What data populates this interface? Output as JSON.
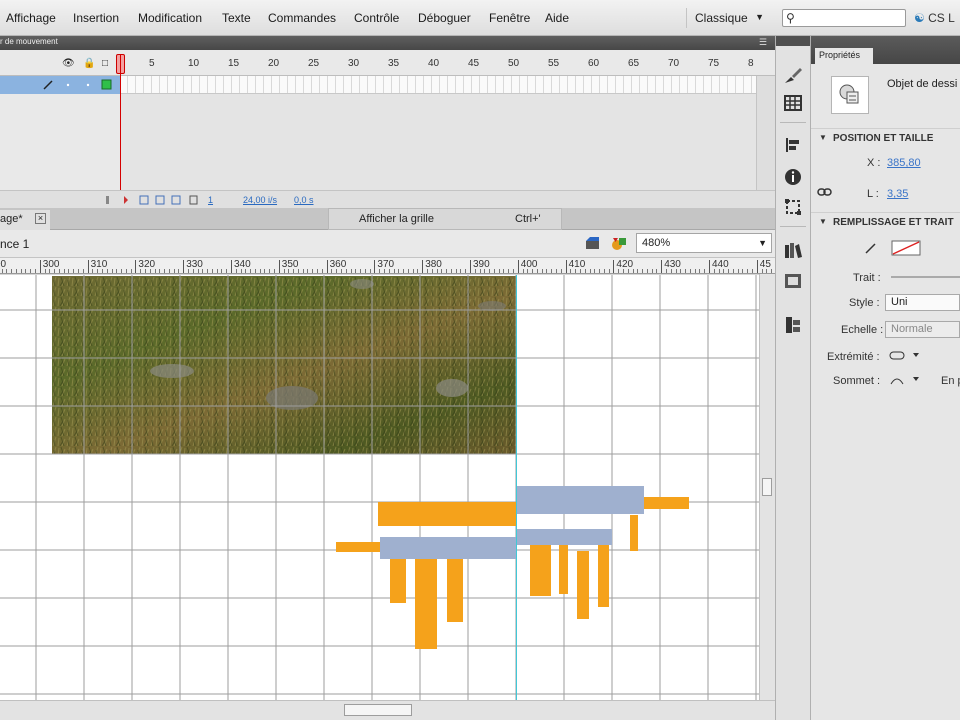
{
  "menu": {
    "items": [
      "Affichage",
      "Insertion",
      "Modification",
      "Texte",
      "Commandes",
      "Contrôle",
      "Déboguer",
      "Fenêtre",
      "Aide"
    ],
    "workspace": "Classique",
    "search_placeholder": "",
    "cs_live": "CS L"
  },
  "timeline": {
    "tab_label": "r de mouvement",
    "frame_numbers": [
      "1",
      "5",
      "10",
      "15",
      "20",
      "25",
      "30",
      "35",
      "40",
      "45",
      "50",
      "55",
      "60",
      "65",
      "70",
      "75",
      "8"
    ],
    "current_frame": "1",
    "fps": "24,00 i/s",
    "time": "0,0 s",
    "colors": {
      "layer_selected": "#8bb3e0",
      "playhead": "#d40000"
    }
  },
  "document": {
    "tab_label": "age*",
    "scene": "nce 1",
    "zoom": "480%"
  },
  "tooltip": {
    "label": "Afficher la grille",
    "shortcut": "Ctrl+'"
  },
  "ruler": {
    "labels": [
      "90",
      "300",
      "310",
      "320",
      "330",
      "340",
      "350",
      "360",
      "370",
      "380",
      "390",
      "400",
      "410",
      "420",
      "430",
      "440",
      "45"
    ]
  },
  "properties": {
    "tab_label": "Propriétés",
    "object_label": "Objet de dessi",
    "section_position": "POSITION ET TAILLE",
    "x_label": "X :",
    "x_value": "385,80",
    "l_label": "L :",
    "l_value": "3,35",
    "section_fill": "REMPLISSAGE ET TRAIT",
    "stroke_label": "Trait :",
    "style_label": "Style :",
    "style_value": "Uni",
    "scale_label": "Echelle :",
    "scale_value": "Normale",
    "cap_label": "Extrémité :",
    "join_label": "Sommet :",
    "join_extra": "En p"
  },
  "stage": {
    "colors": {
      "orange": "#f5a21b",
      "blue": "#9fb0cf",
      "grid": "#9e9e9e",
      "guide": "#40c8d8"
    }
  },
  "icons": {
    "tools": [
      "brush-icon",
      "grid-icon",
      "align-icon",
      "info-icon",
      "transform-icon",
      "library-icon",
      "swatches-icon",
      "components-icon"
    ]
  }
}
